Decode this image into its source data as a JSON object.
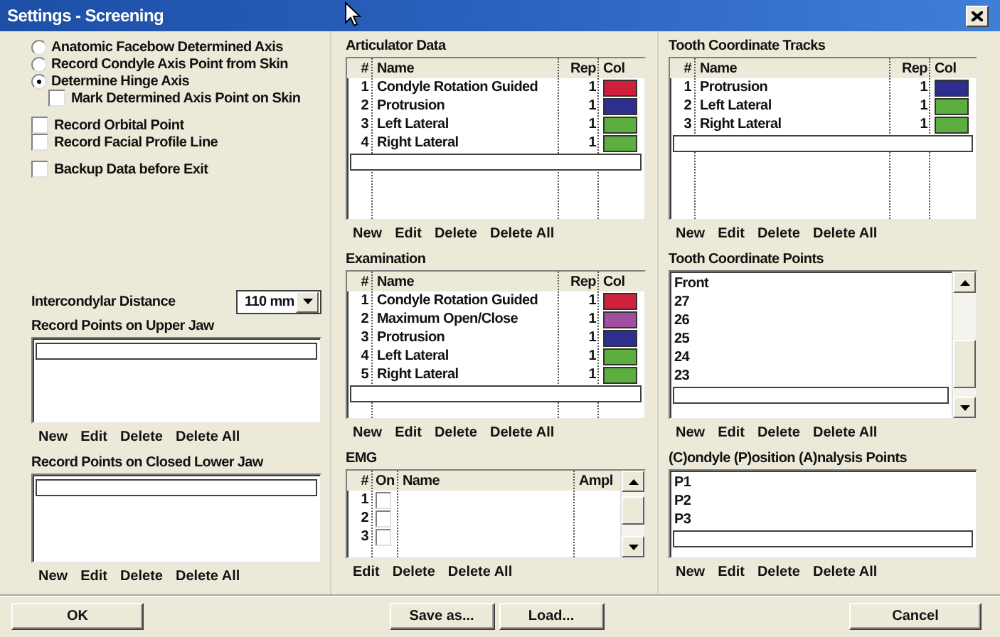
{
  "window": {
    "title": "Settings - Screening"
  },
  "left": {
    "option_groups": [
      {
        "items": [
          {
            "kind": "radio",
            "label": "Anatomic Facebow Determined Axis",
            "selected": false
          },
          {
            "kind": "radio",
            "label": "Record Condyle Axis Point from Skin",
            "selected": false
          },
          {
            "kind": "radio",
            "label": "Determine Hinge Axis",
            "selected": true
          },
          {
            "kind": "subcheckbox",
            "label": "Mark Determined Axis Point on Skin",
            "checked": false
          }
        ]
      },
      {
        "items": [
          {
            "kind": "checkbox",
            "label": "Record Orbital Point",
            "checked": false
          },
          {
            "kind": "checkbox",
            "label": "Record Facial Profile Line",
            "checked": false
          }
        ]
      },
      {
        "items": [
          {
            "kind": "checkbox",
            "label": "Backup Data before Exit",
            "checked": false
          }
        ]
      }
    ],
    "intercondylar": {
      "label": "Intercondylar Distance",
      "value": "110 mm"
    },
    "panels": [
      {
        "kind": "list",
        "title": "Record Points on Upper Jaw",
        "buttons": [
          "New",
          "Edit",
          "Delete",
          "Delete All"
        ]
      },
      {
        "kind": "list",
        "title": "Record Points on Closed Lower Jaw",
        "buttons": [
          "New",
          "Edit",
          "Delete",
          "Delete All"
        ]
      }
    ]
  },
  "middle": {
    "panels": [
      {
        "kind": "table",
        "title": "Articulator Data",
        "columns": [
          "#",
          "Name",
          "Rep",
          "Col"
        ],
        "rows": [
          {
            "number": "1",
            "name": "Condyle Rotation Guided",
            "rep": "1",
            "color": "#d0203c"
          },
          {
            "number": "2",
            "name": "Protrusion",
            "rep": "1",
            "color": "#2e2e8e"
          },
          {
            "number": "3",
            "name": "Left Lateral",
            "rep": "1",
            "color": "#5cae3e"
          },
          {
            "number": "4",
            "name": "Right Lateral",
            "rep": "1",
            "color": "#5cae3e"
          }
        ],
        "buttons": [
          "New",
          "Edit",
          "Delete",
          "Delete All"
        ]
      },
      {
        "kind": "table",
        "title": "Examination",
        "columns": [
          "#",
          "Name",
          "Rep",
          "Col"
        ],
        "rows": [
          {
            "number": "1",
            "name": "Condyle Rotation Guided",
            "rep": "1",
            "color": "#d0203c"
          },
          {
            "number": "2",
            "name": "Maximum Open/Close",
            "rep": "1",
            "color": "#a04ea0"
          },
          {
            "number": "3",
            "name": "Protrusion",
            "rep": "1",
            "color": "#2e2e8e"
          },
          {
            "number": "4",
            "name": "Left Lateral",
            "rep": "1",
            "color": "#5cae3e"
          },
          {
            "number": "5",
            "name": "Right Lateral",
            "rep": "1",
            "color": "#5cae3e"
          }
        ],
        "buttons": [
          "New",
          "Edit",
          "Delete",
          "Delete All"
        ]
      },
      {
        "kind": "emg",
        "title": "EMG",
        "columns": [
          "#",
          "On",
          "Name",
          "Ampl"
        ],
        "scrollbar": true,
        "rows": [
          {
            "number": "1",
            "on": false
          },
          {
            "number": "2",
            "on": false
          },
          {
            "number": "3",
            "on": false
          }
        ],
        "buttons": [
          "Edit",
          "Delete",
          "Delete All"
        ]
      }
    ]
  },
  "right": {
    "panels": [
      {
        "kind": "table",
        "title": "Tooth Coordinate Tracks",
        "columns": [
          "#",
          "Name",
          "Rep",
          "Col"
        ],
        "rows": [
          {
            "number": "1",
            "name": "Protrusion",
            "rep": "1",
            "color": "#2e2e8e"
          },
          {
            "number": "2",
            "name": "Left Lateral",
            "rep": "1",
            "color": "#5cae3e"
          },
          {
            "number": "3",
            "name": "Right Lateral",
            "rep": "1",
            "color": "#5cae3e"
          }
        ],
        "buttons": [
          "New",
          "Edit",
          "Delete",
          "Delete All"
        ]
      },
      {
        "kind": "list",
        "title": "Tooth Coordinate Points",
        "scrollbar": true,
        "items": [
          "Front",
          "27",
          "26",
          "25",
          "24",
          "23"
        ],
        "buttons": [
          "New",
          "Edit",
          "Delete",
          "Delete All"
        ]
      },
      {
        "kind": "list",
        "title": "(C)ondyle (P)osition (A)nalysis Points",
        "items": [
          "P1",
          "P2",
          "P3"
        ],
        "buttons": [
          "New",
          "Edit",
          "Delete",
          "Delete All"
        ]
      }
    ]
  },
  "footer": {
    "left": [
      "OK"
    ],
    "center": [
      "Save as...",
      "Load..."
    ],
    "right": [
      "Cancel"
    ]
  }
}
